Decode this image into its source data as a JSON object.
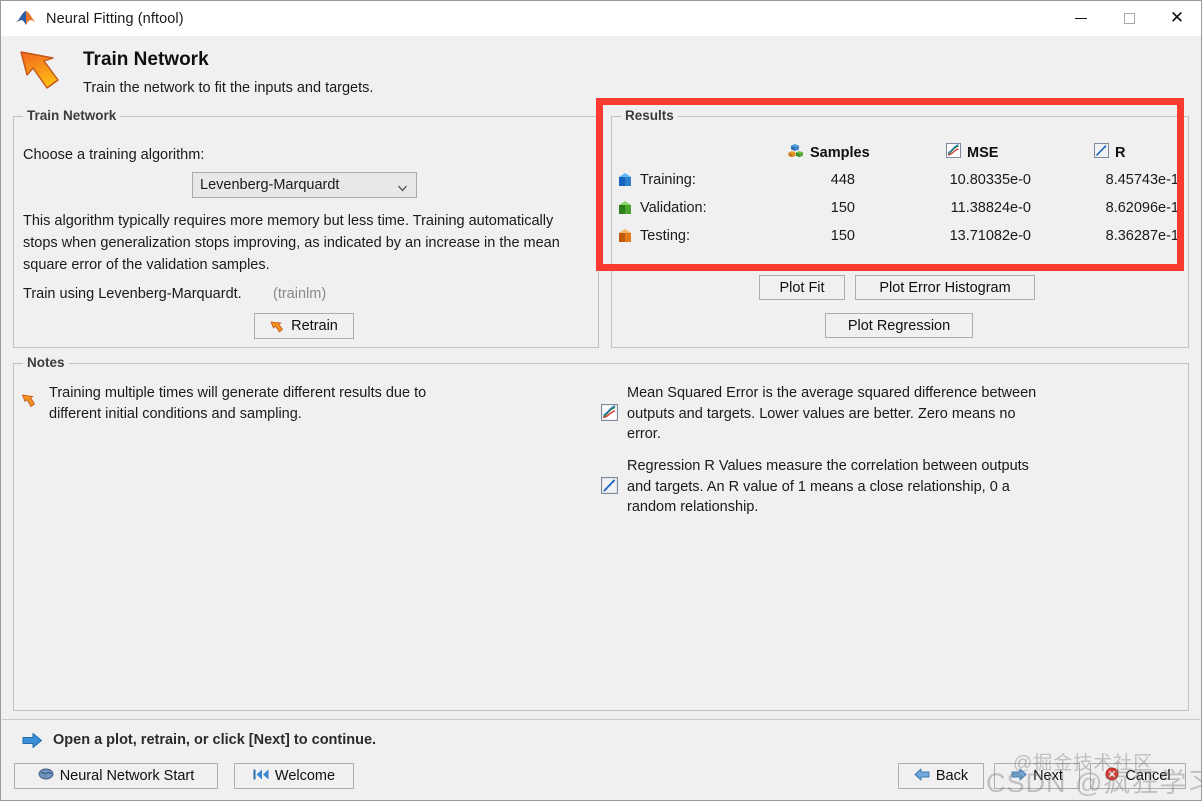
{
  "window": {
    "title": "Neural Fitting (nftool)",
    "app_icon": "matlab-nn-arrow-icon",
    "controls": {
      "minimize": "minimize-icon",
      "maximize": "maximize-icon",
      "close": "close-icon"
    }
  },
  "header": {
    "title": "Train Network",
    "subtitle": "Train the network to fit the inputs and targets.",
    "icon": "orange-arrow-icon"
  },
  "train_panel": {
    "legend": "Train Network",
    "choose_label": "Choose a training algorithm:",
    "algorithm_selected": "Levenberg-Marquardt",
    "algorithm_options": [
      "Levenberg-Marquardt"
    ],
    "description": "This algorithm typically requires more memory but less time. Training automatically stops when generalization stops improving, as indicated by an increase in the mean square error of the validation samples.",
    "train_using": "Train using Levenberg-Marquardt.",
    "train_function": "(trainlm)",
    "retrain_label": "Retrain"
  },
  "results_panel": {
    "legend": "Results",
    "columns": [
      {
        "label": "Samples",
        "icon": "cubes-stack-icon"
      },
      {
        "label": "MSE",
        "icon": "mse-plot-icon"
      },
      {
        "label": "R",
        "icon": "regression-plot-icon"
      }
    ],
    "rows": [
      {
        "name": "Training:",
        "icon": "blue-cube-icon",
        "color": "#2e7fc9",
        "samples": "448",
        "mse": "10.80335e-0",
        "r": "8.45743e-1"
      },
      {
        "name": "Validation:",
        "icon": "green-cube-icon",
        "color": "#3e9c2a",
        "samples": "150",
        "mse": "11.38824e-0",
        "r": "8.62096e-1"
      },
      {
        "name": "Testing:",
        "icon": "orange-cube-icon",
        "color": "#e07a1a",
        "samples": "150",
        "mse": "13.71082e-0",
        "r": "8.36287e-1"
      }
    ],
    "buttons": {
      "plot_fit": "Plot Fit",
      "plot_error_histogram": "Plot Error Histogram",
      "plot_regression": "Plot Regression"
    },
    "highlight_color": "#fb3b30"
  },
  "notes_panel": {
    "legend": "Notes",
    "items": [
      {
        "icon": "orange-arrow-icon",
        "text": "Training multiple times will generate different results due to different initial conditions and sampling."
      },
      {
        "icon": "mse-plot-icon",
        "text": "Mean Squared Error is the average squared difference between outputs and targets. Lower values are better. Zero means no error."
      },
      {
        "icon": "regression-plot-icon",
        "text": "Regression R Values measure the correlation between outputs and targets. An R value of 1 means a close relationship, 0 a random relationship."
      }
    ]
  },
  "footer": {
    "status": "Open a plot, retrain, or click [Next] to continue.",
    "status_icon": "blue-right-arrow-icon",
    "neural_network_start": "Neural Network Start",
    "welcome": "Welcome",
    "back": "Back",
    "next": "Next",
    "cancel": "Cancel"
  },
  "watermarks": {
    "csdn": "CSDN @疯狂学习GIS",
    "juejin": "@掘金技术社区"
  }
}
